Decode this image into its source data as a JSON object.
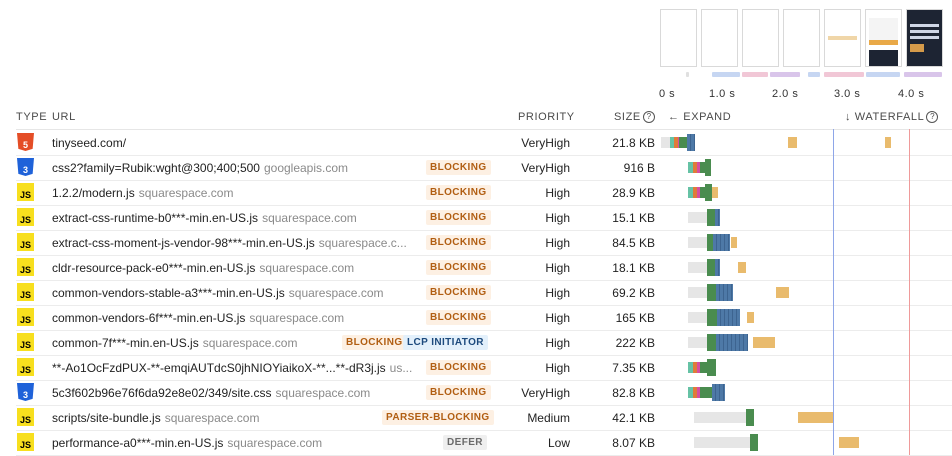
{
  "filmstrip": {
    "frame_count": 7
  },
  "time_axis": [
    "0 s",
    "1.0 s",
    "2.0 s",
    "3.0 s",
    "4.0 s"
  ],
  "headers": {
    "type": "TYPE",
    "url": "URL",
    "priority": "PRIORITY",
    "size": "SIZE",
    "expand": "← EXPAND",
    "waterfall": "↓ WATERFALL"
  },
  "help_glyph": "?",
  "colors": {
    "accent_blue": "#8ea6e8",
    "lcp_red": "#ef9a9a",
    "dns": "#66c2a5",
    "connect": "#e07b39",
    "ssl": "#d64ea1",
    "wait": "#4a8c4f",
    "download": "#4e79a7",
    "blocked": "#e6e6e6",
    "late": "#e9bb6d"
  },
  "rows": [
    {
      "icon": "HTML5",
      "type": "html",
      "url": "tinyseed.com/",
      "domain": "",
      "badges": [],
      "priority": "VeryHigh",
      "size": "21.8 KB"
    },
    {
      "icon": "CSS3",
      "type": "css",
      "url": "css2?family=Rubik:wght@300;400;500",
      "domain": "googleapis.com",
      "badges": [
        "BLOCKING"
      ],
      "priority": "VeryHigh",
      "size": "916 B"
    },
    {
      "icon": "JS",
      "type": "js",
      "url": "1.2.2/modern.js",
      "domain": "squarespace.com",
      "badges": [
        "BLOCKING"
      ],
      "priority": "High",
      "size": "28.9 KB"
    },
    {
      "icon": "JS",
      "type": "js",
      "url": "extract-css-runtime-b0***-min.en-US.js",
      "domain": "squarespace.com",
      "badges": [
        "BLOCKING"
      ],
      "priority": "High",
      "size": "15.1 KB"
    },
    {
      "icon": "JS",
      "type": "js",
      "url": "extract-css-moment-js-vendor-98***-min.en-US.js",
      "domain": "squarespace.c...",
      "badges": [
        "BLOCKING"
      ],
      "priority": "High",
      "size": "84.5 KB"
    },
    {
      "icon": "JS",
      "type": "js",
      "url": "cldr-resource-pack-e0***-min.en-US.js",
      "domain": "squarespace.com",
      "badges": [
        "BLOCKING"
      ],
      "priority": "High",
      "size": "18.1 KB"
    },
    {
      "icon": "JS",
      "type": "js",
      "url": "common-vendors-stable-a3***-min.en-US.js",
      "domain": "squarespace.com",
      "badges": [
        "BLOCKING"
      ],
      "priority": "High",
      "size": "69.2 KB"
    },
    {
      "icon": "JS",
      "type": "js",
      "url": "common-vendors-6f***-min.en-US.js",
      "domain": "squarespace.com",
      "badges": [
        "BLOCKING"
      ],
      "priority": "High",
      "size": "165 KB"
    },
    {
      "icon": "JS",
      "type": "js",
      "url": "common-7f***-min.en-US.js",
      "domain": "squarespace.com",
      "badges": [
        "BLOCKING",
        "LCP INITIATOR"
      ],
      "priority": "High",
      "size": "222 KB"
    },
    {
      "icon": "JS",
      "type": "js",
      "url": "**-Ao1OcFzdPUX-**-emqiAUTdcS0jhNIOYiaikoX-**...**-dR3j.js",
      "domain": "us...",
      "badges": [
        "BLOCKING"
      ],
      "priority": "High",
      "size": "7.35 KB"
    },
    {
      "icon": "CSS3",
      "type": "css",
      "url": "5c3f602b96e76f6da92e8e02/349/site.css",
      "domain": "squarespace.com",
      "badges": [
        "BLOCKING"
      ],
      "priority": "VeryHigh",
      "size": "82.8 KB"
    },
    {
      "icon": "JS",
      "type": "js",
      "url": "scripts/site-bundle.js",
      "domain": "squarespace.com",
      "badges": [
        "PARSER-BLOCKING"
      ],
      "priority": "Medium",
      "size": "42.1 KB"
    },
    {
      "icon": "JS",
      "type": "js",
      "url": "performance-a0***-min.en-US.js",
      "domain": "squarespace.com",
      "badges": [
        "DEFER"
      ],
      "priority": "Low",
      "size": "8.07 KB"
    }
  ]
}
